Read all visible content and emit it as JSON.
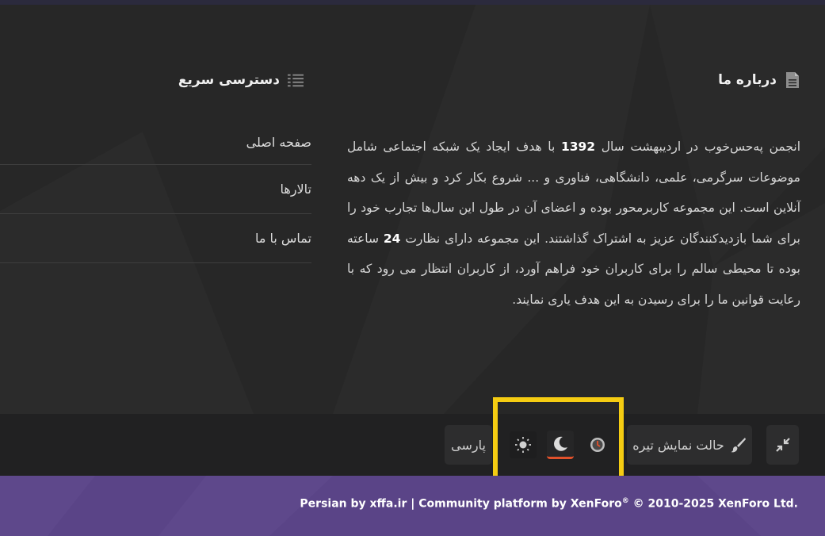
{
  "about": {
    "title": "درباره ما",
    "text_1": "انجمن پەحس‌خوب در اردیبهشت سال ",
    "year": "1392",
    "text_2": " با هدف ایجاد یک شبکه اجتماعی شامل موضوعات سرگرمی، علمی، دانشگاهی، فناوری و ... شروع بکار کرد و بیش از یک دهه آنلاین است. این مجموعه کاربرمحور بوده و اعضای آن در طول این سال‌ها تجارب خود را برای شما بازدیدکنندگان عزیز به اشتراک گذاشتند. این مجموعه دارای نظارت ",
    "hours": "24",
    "text_3": " ساعته بوده تا محیطی سالم را برای کاربران خود فراهم آورد، از کاربران انتظار می رود که با رعایت قوانین ما را برای رسیدن به این هدف یاری نمایند."
  },
  "quick_access": {
    "title": "دسترسی سریع",
    "items": [
      {
        "label": "صفحه اصلی"
      },
      {
        "label": "تالارها"
      },
      {
        "label": "تماس با ما"
      }
    ]
  },
  "footer_bar": {
    "dark_mode_label": "حالت نمایش تیره",
    "language_label": "پارسی",
    "modes": [
      "auto",
      "dark",
      "light"
    ]
  },
  "copyright": {
    "credit": "Persian by xffa.ir | Community platform by XenForo",
    "rights": " © 2010-2025 XenForo Ltd."
  },
  "colors": {
    "background": "#272727",
    "footer": "#212122",
    "copyright_bar": "#5a4487",
    "active_accent": "#e0512b",
    "highlight": "#f5cc12"
  },
  "icons": {
    "about": "document-icon",
    "quick_access": "list-icon",
    "collapse": "compress-icon",
    "dark_mode": "paint-brush-icon",
    "auto_mode": "clock-icon",
    "dark": "moon-icon",
    "light": "sun-icon"
  }
}
